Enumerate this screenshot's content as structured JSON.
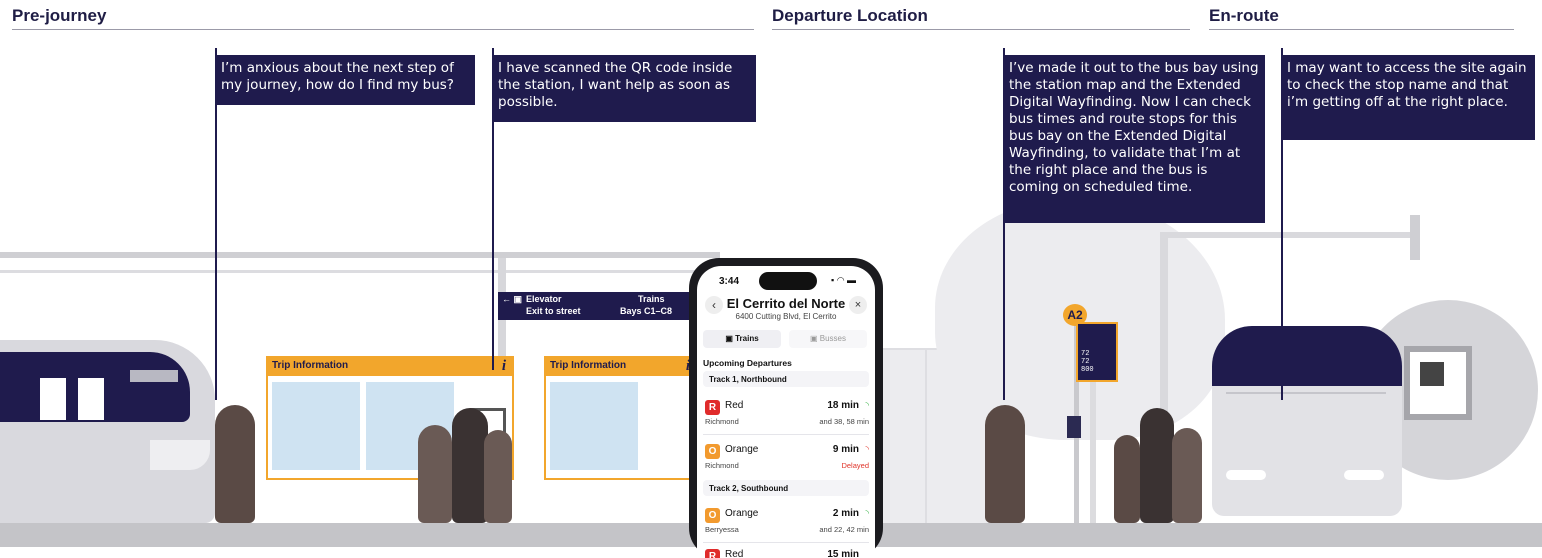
{
  "sections": [
    {
      "title": "Pre-journey"
    },
    {
      "title": "Departure Location"
    },
    {
      "title": "En-route"
    }
  ],
  "callouts": [
    {
      "text": "I’m anxious about the next step of my journey, how do I find my bus?"
    },
    {
      "text": "I have scanned the QR code inside the station, I want help as soon as possible."
    },
    {
      "text": "I’ve made it out to the bus bay using the station map and the Extended Digital Wayfinding. Now I can check bus times and route stops for this bus bay on the Extended Digital Wayfinding, to validate that I’m at the right place and the bus is coming on scheduled time."
    },
    {
      "text": "I may want to access the site again to check the stop name and that i’m getting off at the right place."
    }
  ],
  "directional_sign": {
    "elevator": "Elevator",
    "exit": "Exit to street",
    "trains": "Trains",
    "bays": "Bays C1–C8"
  },
  "kiosks": [
    {
      "title": "Trip Information",
      "info_glyph": "i"
    },
    {
      "title": "Trip Information",
      "info_glyph": "i"
    }
  ],
  "bus_stop": {
    "bay": "A2",
    "times": [
      "72",
      "72",
      "800"
    ]
  },
  "phone": {
    "time": "3:44",
    "station": "El Cerrito del Norte",
    "address": "6400 Cutting Blvd, El Cerrito",
    "tabs": {
      "trains": "Trains",
      "busses": "Busses"
    },
    "upcoming_label": "Upcoming Departures",
    "tracks": [
      {
        "label": "Track 1, Northbound",
        "departures": [
          {
            "badge": "R",
            "line": "Red",
            "dest": "Richmond",
            "eta": "18 min",
            "more": "and 38, 58 min",
            "color": "#e02b2b",
            "delayed": false
          },
          {
            "badge": "O",
            "line": "Orange",
            "dest": "Richmond",
            "eta": "9 min",
            "more": "Delayed",
            "color": "#f29a2e",
            "delayed": true
          }
        ]
      },
      {
        "label": "Track 2, Southbound",
        "departures": [
          {
            "badge": "O",
            "line": "Orange",
            "dest": "Berryessa",
            "eta": "2 min",
            "more": "and 22, 42 min",
            "color": "#f29a2e",
            "delayed": false
          },
          {
            "badge": "R",
            "line": "Red",
            "dest": "",
            "eta": "15 min",
            "more": "",
            "color": "#e02b2b",
            "delayed": false
          }
        ]
      }
    ]
  },
  "colors": {
    "navy": "#1f1b4d",
    "sign_orange": "#f2a62c",
    "live_green": "#3bb54a",
    "delay_red": "#e0352b"
  }
}
